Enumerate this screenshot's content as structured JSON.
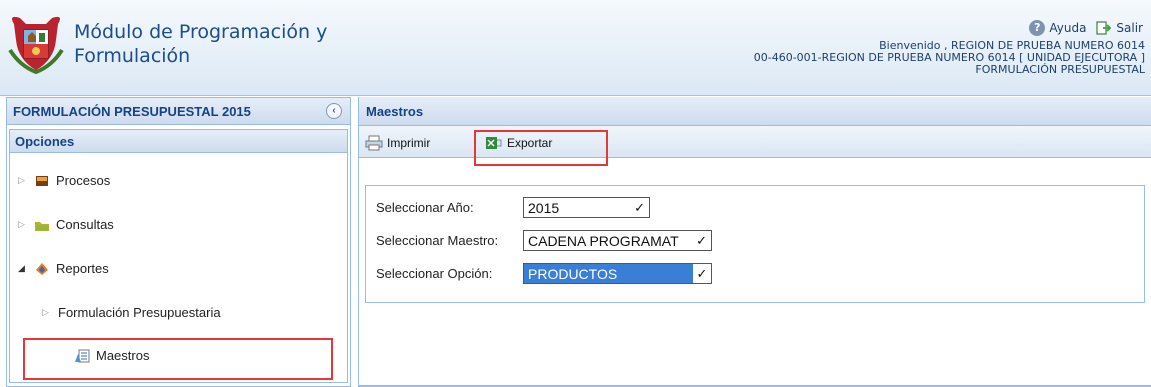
{
  "header": {
    "title_line1": "Módulo de Programación y",
    "title_line2": "Formulación",
    "help_label": "Ayuda",
    "exit_label": "Salir",
    "user_line1": "Bienvenido , REGION DE PRUEBA NUMERO 6014",
    "user_line2": "00-460-001-REGION DE PRUEBA NUMERO 6014 [ UNIDAD EJECUTORA ]",
    "user_line3": "FORMULACIÓN PRESUPUESTAL"
  },
  "sidebar": {
    "title": "FORMULACIÓN PRESUPUESTAL 2015",
    "section_title": "Opciones",
    "items": [
      {
        "label": "Procesos",
        "icon": "folder-book-icon"
      },
      {
        "label": "Consultas",
        "icon": "folder-search-icon"
      },
      {
        "label": "Reportes",
        "icon": "reports-icon"
      },
      {
        "label": "Formulación Presupuestaria",
        "icon": ""
      },
      {
        "label": "Maestros",
        "icon": "masters-doc-icon"
      }
    ]
  },
  "main": {
    "title": "Maestros",
    "toolbar": {
      "print_label": "Imprimir",
      "export_label": "Exportar"
    },
    "form": {
      "year_label": "Seleccionar Año:",
      "year_value": "2015",
      "master_label": "Seleccionar Maestro:",
      "master_value": "CADENA PROGRAMAT",
      "option_label": "Seleccionar Opción:",
      "option_value": "PRODUCTOS"
    }
  },
  "colors": {
    "header_text": "#1a4e8c",
    "panel_title": "#15428b",
    "highlight": "#e53939",
    "selected_option": "#3a7fd6"
  }
}
